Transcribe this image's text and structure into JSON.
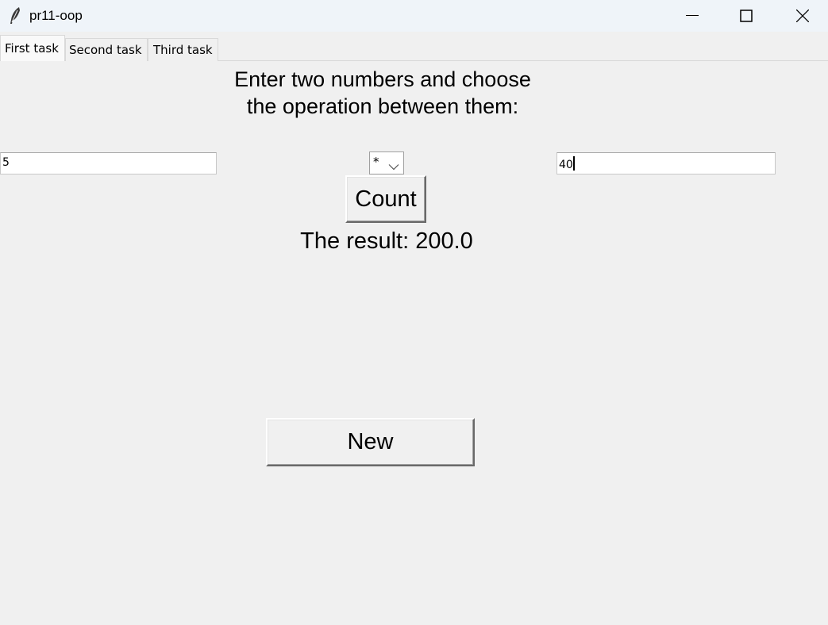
{
  "window": {
    "title": "pr11-oop",
    "icon": "feather-icon",
    "controls": [
      "minimize-icon",
      "maximize-icon",
      "close-icon"
    ]
  },
  "tabs": [
    {
      "label": "First task",
      "active": true
    },
    {
      "label": "Second task",
      "active": false
    },
    {
      "label": "Third task",
      "active": false
    }
  ],
  "first_task": {
    "heading": "Enter two numbers and choose\nthe operation between them:",
    "first_number": {
      "value": "5"
    },
    "operation": {
      "selected": "*"
    },
    "second_number": {
      "value": "40"
    },
    "count_button": "Count",
    "result_text": "The result: 200.0",
    "new_button": "New"
  }
}
